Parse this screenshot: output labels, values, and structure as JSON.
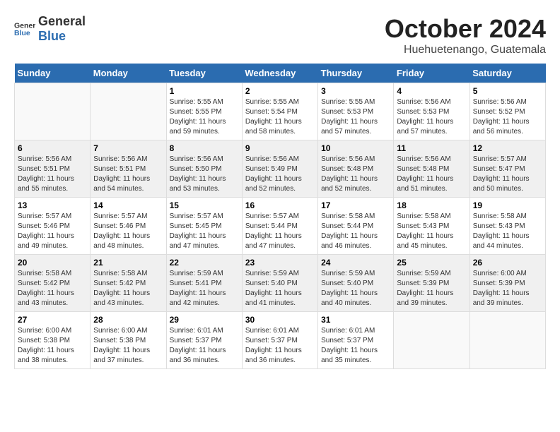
{
  "logo": {
    "general": "General",
    "blue": "Blue"
  },
  "header": {
    "month": "October 2024",
    "location": "Huehuetenango, Guatemala"
  },
  "weekdays": [
    "Sunday",
    "Monday",
    "Tuesday",
    "Wednesday",
    "Thursday",
    "Friday",
    "Saturday"
  ],
  "weeks": [
    [
      {
        "day": null,
        "sunrise": null,
        "sunset": null,
        "daylight": null
      },
      {
        "day": null,
        "sunrise": null,
        "sunset": null,
        "daylight": null
      },
      {
        "day": "1",
        "sunrise": "Sunrise: 5:55 AM",
        "sunset": "Sunset: 5:55 PM",
        "daylight": "Daylight: 11 hours and 59 minutes."
      },
      {
        "day": "2",
        "sunrise": "Sunrise: 5:55 AM",
        "sunset": "Sunset: 5:54 PM",
        "daylight": "Daylight: 11 hours and 58 minutes."
      },
      {
        "day": "3",
        "sunrise": "Sunrise: 5:55 AM",
        "sunset": "Sunset: 5:53 PM",
        "daylight": "Daylight: 11 hours and 57 minutes."
      },
      {
        "day": "4",
        "sunrise": "Sunrise: 5:56 AM",
        "sunset": "Sunset: 5:53 PM",
        "daylight": "Daylight: 11 hours and 57 minutes."
      },
      {
        "day": "5",
        "sunrise": "Sunrise: 5:56 AM",
        "sunset": "Sunset: 5:52 PM",
        "daylight": "Daylight: 11 hours and 56 minutes."
      }
    ],
    [
      {
        "day": "6",
        "sunrise": "Sunrise: 5:56 AM",
        "sunset": "Sunset: 5:51 PM",
        "daylight": "Daylight: 11 hours and 55 minutes."
      },
      {
        "day": "7",
        "sunrise": "Sunrise: 5:56 AM",
        "sunset": "Sunset: 5:51 PM",
        "daylight": "Daylight: 11 hours and 54 minutes."
      },
      {
        "day": "8",
        "sunrise": "Sunrise: 5:56 AM",
        "sunset": "Sunset: 5:50 PM",
        "daylight": "Daylight: 11 hours and 53 minutes."
      },
      {
        "day": "9",
        "sunrise": "Sunrise: 5:56 AM",
        "sunset": "Sunset: 5:49 PM",
        "daylight": "Daylight: 11 hours and 52 minutes."
      },
      {
        "day": "10",
        "sunrise": "Sunrise: 5:56 AM",
        "sunset": "Sunset: 5:48 PM",
        "daylight": "Daylight: 11 hours and 52 minutes."
      },
      {
        "day": "11",
        "sunrise": "Sunrise: 5:56 AM",
        "sunset": "Sunset: 5:48 PM",
        "daylight": "Daylight: 11 hours and 51 minutes."
      },
      {
        "day": "12",
        "sunrise": "Sunrise: 5:57 AM",
        "sunset": "Sunset: 5:47 PM",
        "daylight": "Daylight: 11 hours and 50 minutes."
      }
    ],
    [
      {
        "day": "13",
        "sunrise": "Sunrise: 5:57 AM",
        "sunset": "Sunset: 5:46 PM",
        "daylight": "Daylight: 11 hours and 49 minutes."
      },
      {
        "day": "14",
        "sunrise": "Sunrise: 5:57 AM",
        "sunset": "Sunset: 5:46 PM",
        "daylight": "Daylight: 11 hours and 48 minutes."
      },
      {
        "day": "15",
        "sunrise": "Sunrise: 5:57 AM",
        "sunset": "Sunset: 5:45 PM",
        "daylight": "Daylight: 11 hours and 47 minutes."
      },
      {
        "day": "16",
        "sunrise": "Sunrise: 5:57 AM",
        "sunset": "Sunset: 5:44 PM",
        "daylight": "Daylight: 11 hours and 47 minutes."
      },
      {
        "day": "17",
        "sunrise": "Sunrise: 5:58 AM",
        "sunset": "Sunset: 5:44 PM",
        "daylight": "Daylight: 11 hours and 46 minutes."
      },
      {
        "day": "18",
        "sunrise": "Sunrise: 5:58 AM",
        "sunset": "Sunset: 5:43 PM",
        "daylight": "Daylight: 11 hours and 45 minutes."
      },
      {
        "day": "19",
        "sunrise": "Sunrise: 5:58 AM",
        "sunset": "Sunset: 5:43 PM",
        "daylight": "Daylight: 11 hours and 44 minutes."
      }
    ],
    [
      {
        "day": "20",
        "sunrise": "Sunrise: 5:58 AM",
        "sunset": "Sunset: 5:42 PM",
        "daylight": "Daylight: 11 hours and 43 minutes."
      },
      {
        "day": "21",
        "sunrise": "Sunrise: 5:58 AM",
        "sunset": "Sunset: 5:42 PM",
        "daylight": "Daylight: 11 hours and 43 minutes."
      },
      {
        "day": "22",
        "sunrise": "Sunrise: 5:59 AM",
        "sunset": "Sunset: 5:41 PM",
        "daylight": "Daylight: 11 hours and 42 minutes."
      },
      {
        "day": "23",
        "sunrise": "Sunrise: 5:59 AM",
        "sunset": "Sunset: 5:40 PM",
        "daylight": "Daylight: 11 hours and 41 minutes."
      },
      {
        "day": "24",
        "sunrise": "Sunrise: 5:59 AM",
        "sunset": "Sunset: 5:40 PM",
        "daylight": "Daylight: 11 hours and 40 minutes."
      },
      {
        "day": "25",
        "sunrise": "Sunrise: 5:59 AM",
        "sunset": "Sunset: 5:39 PM",
        "daylight": "Daylight: 11 hours and 39 minutes."
      },
      {
        "day": "26",
        "sunrise": "Sunrise: 6:00 AM",
        "sunset": "Sunset: 5:39 PM",
        "daylight": "Daylight: 11 hours and 39 minutes."
      }
    ],
    [
      {
        "day": "27",
        "sunrise": "Sunrise: 6:00 AM",
        "sunset": "Sunset: 5:38 PM",
        "daylight": "Daylight: 11 hours and 38 minutes."
      },
      {
        "day": "28",
        "sunrise": "Sunrise: 6:00 AM",
        "sunset": "Sunset: 5:38 PM",
        "daylight": "Daylight: 11 hours and 37 minutes."
      },
      {
        "day": "29",
        "sunrise": "Sunrise: 6:01 AM",
        "sunset": "Sunset: 5:37 PM",
        "daylight": "Daylight: 11 hours and 36 minutes."
      },
      {
        "day": "30",
        "sunrise": "Sunrise: 6:01 AM",
        "sunset": "Sunset: 5:37 PM",
        "daylight": "Daylight: 11 hours and 36 minutes."
      },
      {
        "day": "31",
        "sunrise": "Sunrise: 6:01 AM",
        "sunset": "Sunset: 5:37 PM",
        "daylight": "Daylight: 11 hours and 35 minutes."
      },
      {
        "day": null,
        "sunrise": null,
        "sunset": null,
        "daylight": null
      },
      {
        "day": null,
        "sunrise": null,
        "sunset": null,
        "daylight": null
      }
    ]
  ]
}
